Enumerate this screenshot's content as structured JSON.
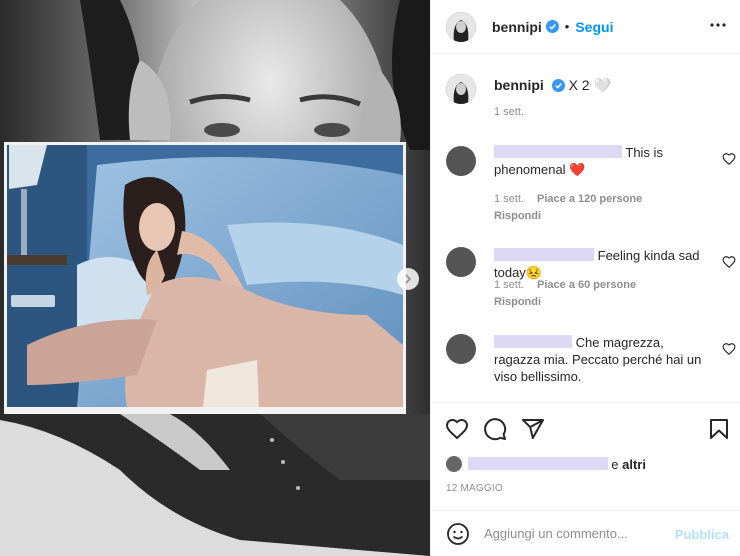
{
  "post": {
    "username": "bennipi",
    "follow_label": "Segui",
    "separator": "•",
    "caption_text": "X 2 🤍",
    "caption_time": "1 sett."
  },
  "comments": [
    {
      "text": "This is phenomenal ❤️",
      "time": "1 sett.",
      "likes_label": "Piace a 120 persone",
      "reply_label": "Rispondi"
    },
    {
      "text": "Feeling kinda sad today😣",
      "time": "1 sett.",
      "likes_label": "Piace a 60 persone",
      "reply_label": "Rispondi"
    },
    {
      "text": "Che magrezza, ragazza mia. Peccato perché hai un viso bellissimo."
    }
  ],
  "likes": {
    "suffix": "e",
    "others_label": "altri"
  },
  "post_date": "12 MAGGIO",
  "add_comment": {
    "placeholder": "Aggiungi un commento...",
    "publish_label": "Pubblica"
  },
  "colors": {
    "link_blue": "#0095f6",
    "publish_disabled": "#b2dffc",
    "redaction": "#ddd8f4",
    "muted_text": "#8e8e8e"
  },
  "icons": [
    "more-options-icon",
    "verified-badge-icon",
    "heart-icon",
    "comment-icon",
    "share-icon",
    "bookmark-icon",
    "emoji-icon",
    "chevron-right-icon"
  ]
}
